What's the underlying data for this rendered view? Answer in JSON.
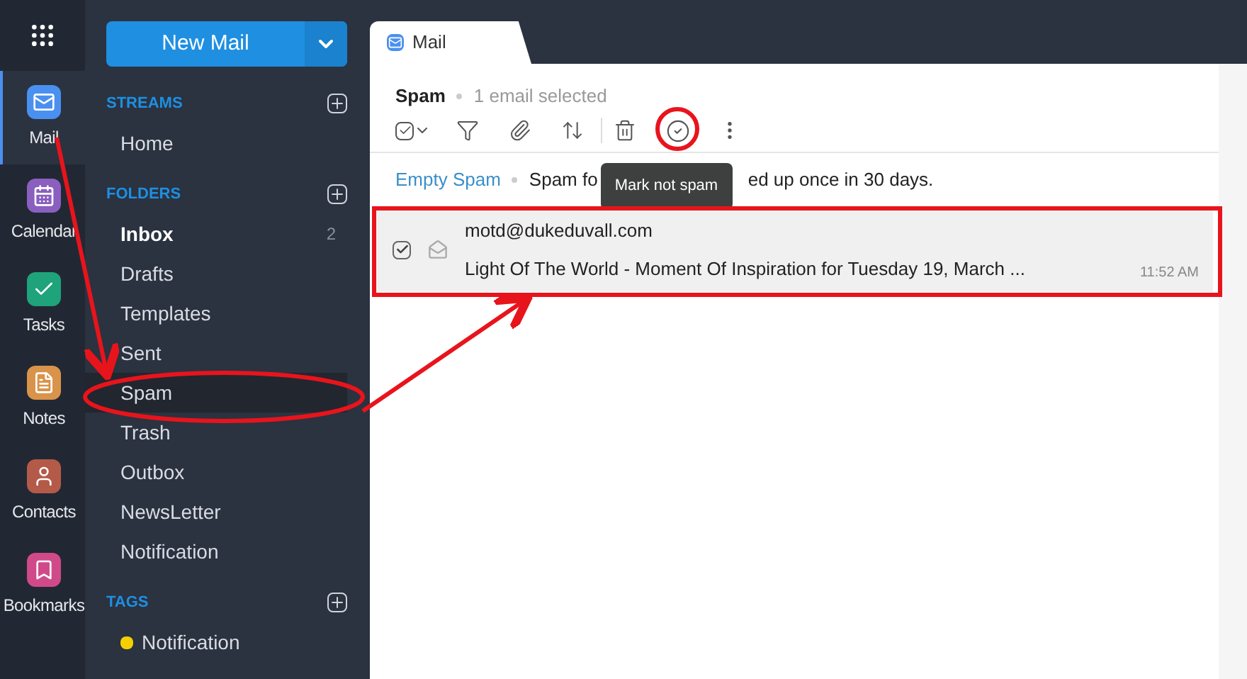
{
  "rail": [
    {
      "label": "Mail",
      "kind": "mail",
      "selected": true
    },
    {
      "label": "Calendar",
      "kind": "calendar",
      "selected": false
    },
    {
      "label": "Tasks",
      "kind": "tasks",
      "selected": false
    },
    {
      "label": "Notes",
      "kind": "notes",
      "selected": false
    },
    {
      "label": "Contacts",
      "kind": "contacts",
      "selected": false
    },
    {
      "label": "Bookmarks",
      "kind": "bookmarks",
      "selected": false
    }
  ],
  "new_mail": "New Mail",
  "sections": [
    {
      "title": "STREAMS",
      "items": [
        {
          "label": "Home",
          "selected": false,
          "bold": false
        }
      ]
    },
    {
      "title": "FOLDERS",
      "items": [
        {
          "label": "Inbox",
          "selected": false,
          "bold": true,
          "count": "2"
        },
        {
          "label": "Drafts",
          "selected": false,
          "bold": false
        },
        {
          "label": "Templates",
          "selected": false,
          "bold": false
        },
        {
          "label": "Sent",
          "selected": false,
          "bold": false
        },
        {
          "label": "Spam",
          "selected": true,
          "bold": false
        },
        {
          "label": "Trash",
          "selected": false,
          "bold": false
        },
        {
          "label": "Outbox",
          "selected": false,
          "bold": false
        },
        {
          "label": "NewsLetter",
          "selected": false,
          "bold": false
        },
        {
          "label": "Notification",
          "selected": false,
          "bold": false
        }
      ]
    },
    {
      "title": "TAGS",
      "items": [
        {
          "label": "Notification",
          "selected": false,
          "bold": false,
          "color": "#f5d000"
        }
      ]
    }
  ],
  "tab": {
    "label": "Mail"
  },
  "header": {
    "folder": "Spam",
    "selection": "1 email selected"
  },
  "tooltip": "Mark not spam",
  "info": {
    "link": "Empty Spam",
    "text_start": "Spam fo",
    "text_end": "ed up once in 30 days."
  },
  "messages": [
    {
      "sender": "motd@dukeduvall.com",
      "subject": "Light Of The World - Moment Of Inspiration for Tuesday 19, March ...",
      "time": "11:52 AM",
      "checked": true
    }
  ]
}
